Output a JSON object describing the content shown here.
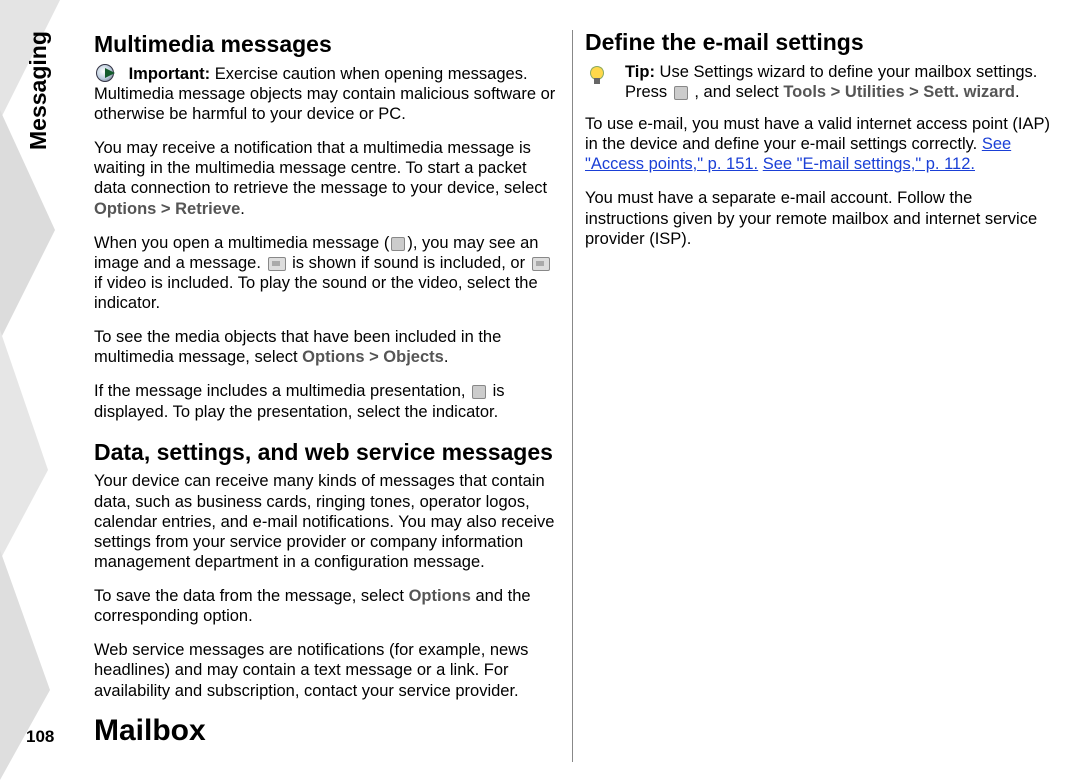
{
  "sideTab": "Messaging",
  "pageNumber": "108",
  "col": {
    "h_multimedia": "Multimedia messages",
    "important_label": "Important:",
    "important_body": "  Exercise caution when opening messages. Multimedia message objects may contain malicious software or otherwise be harmful to your device or PC.",
    "mm_p1_a": "You may receive a notification that a multimedia message is waiting in the multimedia message centre. To start a packet data connection to retrieve the message to your device, select ",
    "mm_p1_path": "Options > Retrieve",
    "mm_p1_end": ".",
    "mm_p2_a": "When you open a multimedia message (",
    "mm_p2_b": "), you may see an image and a message. ",
    "mm_p2_c": " is shown if sound is included, or ",
    "mm_p2_d": " if video is included. To play the sound or the video, select the indicator.",
    "mm_p3_a": "To see the media objects that have been included in the multimedia message, select ",
    "mm_p3_path": "Options > Objects",
    "mm_p3_end": ".",
    "mm_p4_a": "If the message includes a multimedia presentation, ",
    "mm_p4_b": " is displayed. To play the presentation, select the indicator.",
    "h_data": "Data, settings, and web service messages",
    "data_p1": "Your device can receive many kinds of messages that contain data, such as business cards, ringing tones, operator logos, calendar entries, and e-mail notifications. You may also receive settings from your service provider or company information management department in a configuration message.",
    "data_p2_a": "To save the data from the message, select ",
    "data_p2_b": "Options",
    "data_p2_c": " and the corresponding option.",
    "data_p3": "Web service messages are notifications (for example, news headlines) and may contain a text message or a link. For availability and subscription, contact your service provider.",
    "h_mailbox": "Mailbox",
    "h_define": "Define the e-mail settings",
    "tip_label": "Tip:",
    "tip_body_a": " Use Settings wizard to define your mailbox settings. Press ",
    "tip_body_b": " , and select ",
    "tip_path": "Tools > Utilities > Sett. wizard",
    "tip_end": ".",
    "email_p1_a": "To use e-mail, you must have a valid internet access point (IAP) in the device and define your e-mail settings correctly. ",
    "email_link1": "See \"Access points,\" p. 151.",
    "email_link2": "See \"E-mail settings,\" p. 112.",
    "email_p2": "You must have a separate e-mail account. Follow the instructions given by your remote mailbox and internet service provider (ISP)."
  }
}
